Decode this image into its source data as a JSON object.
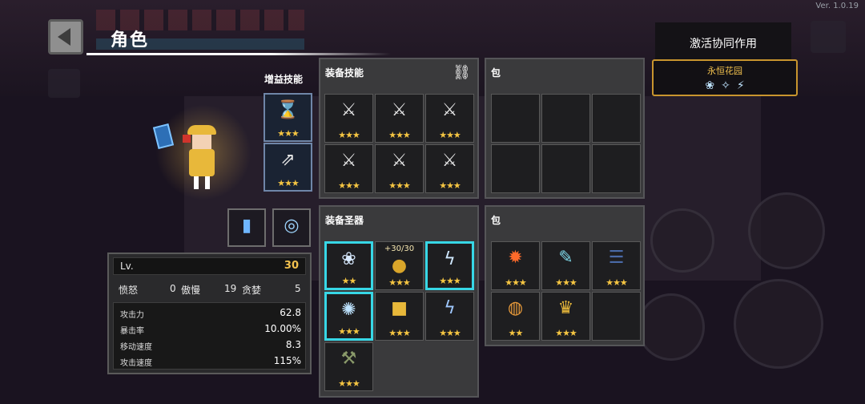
{
  "version": "Ver. 1.0.19",
  "header": {
    "title": "角色"
  },
  "synergy": {
    "title": "激活协同作用",
    "set_name": "永恒花园",
    "icons": [
      "❀",
      "✧",
      "⚡"
    ]
  },
  "buff_skills": {
    "label": "增益技能",
    "slots": [
      {
        "icon": "⌛",
        "stars": "★★★"
      },
      {
        "icon": "⇗",
        "stars": "★★★"
      }
    ]
  },
  "equip_skills": {
    "title": "装备技能",
    "link_icon": "⛓",
    "slots": [
      {
        "icon": "⚔",
        "stars": "★★★"
      },
      {
        "icon": "⚔",
        "stars": "★★★"
      },
      {
        "icon": "⚔",
        "stars": "★★★"
      },
      {
        "icon": "⚔",
        "stars": "★★★"
      },
      {
        "icon": "⚔",
        "stars": "★★★"
      },
      {
        "icon": "⚔",
        "stars": "★★★"
      }
    ]
  },
  "skill_bag": {
    "title": "包"
  },
  "equip_relics": {
    "title": "装备圣器",
    "slots": [
      {
        "icon": "❀",
        "stars": "★★",
        "count": ""
      },
      {
        "icon": "●",
        "stars": "★★★",
        "count": "+30/30"
      },
      {
        "icon": "ϟ",
        "stars": "★★★",
        "count": ""
      },
      {
        "icon": "✺",
        "stars": "★★★",
        "count": ""
      },
      {
        "icon": "■",
        "stars": "★★★",
        "count": ""
      },
      {
        "icon": "ϟ",
        "stars": "★★★",
        "count": ""
      },
      {
        "icon": "⚒",
        "stars": "★★★",
        "count": ""
      }
    ]
  },
  "relic_bag": {
    "title": "包",
    "slots": [
      {
        "icon": "✹",
        "stars": "★★★"
      },
      {
        "icon": "✎",
        "stars": "★★★"
      },
      {
        "icon": "☰",
        "stars": "★★★"
      },
      {
        "icon": "◍",
        "stars": "★★"
      },
      {
        "icon": "♛",
        "stars": "★★★"
      },
      {
        "icon": "",
        "stars": ""
      }
    ]
  },
  "stats": {
    "lv_label": "Lv.",
    "lv_value": "30",
    "sins": [
      {
        "name": "愤怒",
        "value": "0"
      },
      {
        "name": "傲慢",
        "value": "19"
      },
      {
        "name": "贪婪",
        "value": "5"
      }
    ],
    "attributes": [
      {
        "name": "攻击力",
        "value": "62.8"
      },
      {
        "name": "暴击率",
        "value": "10.00%"
      },
      {
        "name": "移动速度",
        "value": "8.3"
      },
      {
        "name": "攻击速度",
        "value": "115%"
      }
    ]
  },
  "colors": {
    "accent_gold": "#f2c14e",
    "highlight_cyan": "#37d7e6",
    "synergy_border": "#c8952e"
  }
}
